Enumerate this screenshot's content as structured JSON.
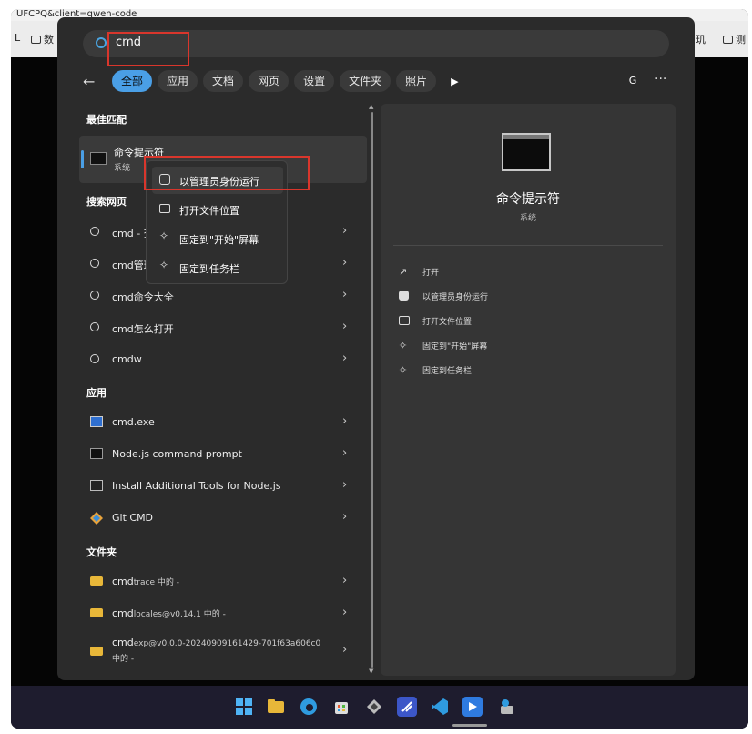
{
  "browser": {
    "url_fragment": "UFCPQ&client=qwen-code",
    "bookmark_left_1": "L",
    "bookmark_left_2": "数",
    "bookmark_right_1": "玑",
    "bookmark_right_2": "测"
  },
  "search": {
    "query": "cmd"
  },
  "filters": {
    "back": "←",
    "chips": [
      "全部",
      "应用",
      "文档",
      "网页",
      "设置",
      "文件夹",
      "照片"
    ],
    "active_index": 0,
    "avatar_letter": "G",
    "more": "···"
  },
  "best_match": {
    "section": "最佳匹配",
    "title": "命令提示符",
    "subtitle": "系统"
  },
  "web_search": {
    "section": "搜索网页",
    "items": [
      "cmd - 查",
      "cmd管理",
      "cmd命令大全",
      "cmd怎么打开",
      "cmdw"
    ]
  },
  "apps": {
    "section": "应用",
    "items": [
      "cmd.exe",
      "Node.js command prompt",
      "Install Additional Tools for Node.js",
      "Git CMD"
    ]
  },
  "folders": {
    "section": "文件夹",
    "items": [
      {
        "name": "cmd",
        "suffix": "trace 中的 -"
      },
      {
        "name": "cmd",
        "suffix": "locales@v0.14.1 中的 -"
      },
      {
        "name": "cmd",
        "suffix": "exp@v0.0.0-20240909161429-701f63a606c0",
        "suffix2": "中的 -"
      }
    ]
  },
  "context_menu": {
    "items": [
      "以管理员身份运行",
      "打开文件位置",
      "固定到\"开始\"屏幕",
      "固定到任务栏"
    ]
  },
  "detail": {
    "title": "命令提示符",
    "subtitle": "系统",
    "actions": [
      "打开",
      "以管理员身份运行",
      "打开文件位置",
      "固定到\"开始\"屏幕",
      "固定到任务栏"
    ]
  },
  "colors": {
    "accent": "#4a9fe6",
    "highlight_box": "#d9362c",
    "panel_bg": "#2b2b2b",
    "detail_bg": "#353535",
    "taskbar_bg": "#1e1c2e"
  },
  "taskbar": {
    "icons": [
      "windows-start-icon",
      "file-explorer-icon",
      "edge-icon",
      "store-icon",
      "app-icon",
      "vs-icon",
      "vscode-icon",
      "media-icon",
      "tool-icon"
    ]
  },
  "chevron": "›"
}
